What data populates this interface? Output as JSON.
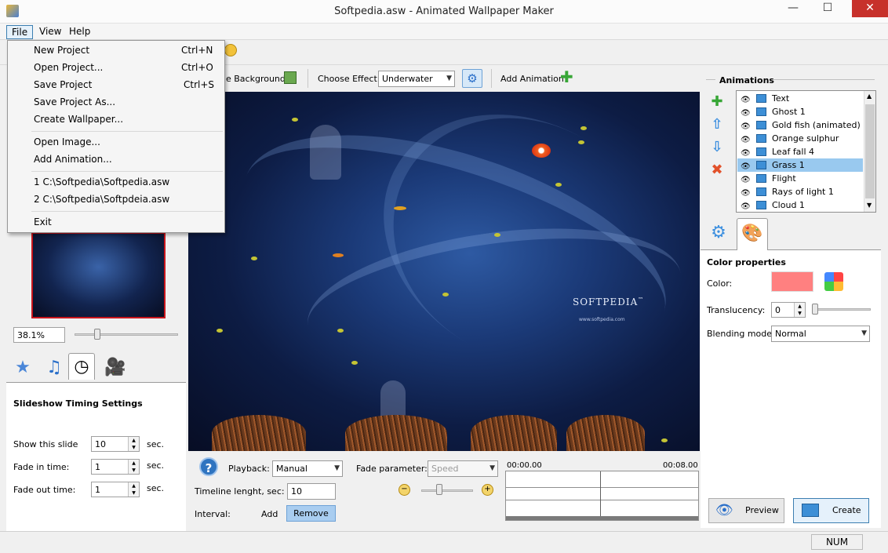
{
  "window": {
    "title": "Softpedia.asw - Animated Wallpaper Maker"
  },
  "menubar": {
    "file": "File",
    "view": "View",
    "help": "Help"
  },
  "file_menu": {
    "new_project": "New Project",
    "new_project_sc": "Ctrl+N",
    "open_project": "Open Project...",
    "open_project_sc": "Ctrl+O",
    "save_project": "Save Project",
    "save_project_sc": "Ctrl+S",
    "save_project_as": "Save Project As...",
    "create_wallpaper": "Create Wallpaper...",
    "open_image": "Open Image...",
    "add_animation": "Add Animation...",
    "recent_1": "1 C:\\Softpedia\\Softpedia.asw",
    "recent_2": "2 C:\\Softpedia\\Softpdeia.asw",
    "exit": "Exit"
  },
  "center_toolbar": {
    "background_label": "e Background",
    "choose_effect_label": "Choose Effect:",
    "effect_value": "Underwater",
    "add_animation_label": "Add Animation"
  },
  "canvas": {
    "logo": "SOFTPEDIA",
    "logo_tm": "™",
    "url": "www.softpedia.com"
  },
  "left": {
    "zoom": "38.1%",
    "timing_title": "Slideshow Timing Settings",
    "show_slide_label": "Show this slide",
    "show_slide_value": "10",
    "show_slide_unit": "sec.",
    "fade_in_label": "Fade in time:",
    "fade_in_value": "1",
    "fade_in_unit": "sec.",
    "fade_out_label": "Fade out time:",
    "fade_out_value": "1",
    "fade_out_unit": "sec."
  },
  "bottom": {
    "playback_label": "Playback:",
    "playback_value": "Manual",
    "fade_param_label": "Fade parameter:",
    "fade_param_value": "Speed",
    "timeline_length_label": "Timeline lenght, sec:",
    "timeline_length_value": "10",
    "interval_label": "Interval:",
    "add_label": "Add",
    "remove_label": "Remove",
    "time_start": "00:00.00",
    "time_end": "00:08.00"
  },
  "animations": {
    "title": "Animations",
    "items": [
      {
        "label": "Text"
      },
      {
        "label": "Ghost 1"
      },
      {
        "label": "Gold fish (animated)"
      },
      {
        "label": "Orange sulphur"
      },
      {
        "label": "Leaf fall 4"
      },
      {
        "label": "Grass 1"
      },
      {
        "label": "Flight"
      },
      {
        "label": "Rays of light 1"
      },
      {
        "label": "Cloud 1"
      }
    ],
    "selected_index": 5
  },
  "color_properties": {
    "title": "Color properties",
    "color_label": "Color:",
    "color_value": "#ff8080",
    "translucency_label": "Translucency:",
    "translucency_value": "0",
    "blending_label": "Blending mode:",
    "blending_value": "Normal"
  },
  "buttons": {
    "preview": "Preview",
    "create": "Create"
  },
  "statusbar": {
    "num": "NUM"
  }
}
